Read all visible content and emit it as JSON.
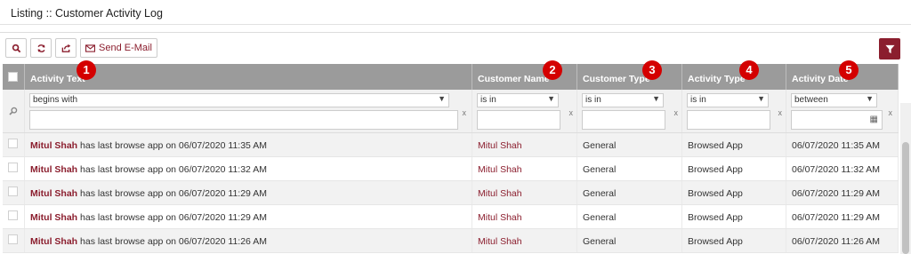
{
  "page": {
    "title": "Listing :: Customer Activity Log"
  },
  "toolbar": {
    "search_icon": "search-icon",
    "refresh_icon": "refresh-icon",
    "export_icon": "export-icon",
    "email_label": "Send E-Mail",
    "filter_icon": "funnel-icon",
    "accent_color": "#8b1e2e"
  },
  "columns": [
    {
      "label": "Activity Text",
      "badge": "1"
    },
    {
      "label": "Customer Name",
      "badge": "2"
    },
    {
      "label": "Customer Type",
      "badge": "3"
    },
    {
      "label": "Activity Type",
      "badge": "4"
    },
    {
      "label": "Activity Date",
      "badge": "5"
    }
  ],
  "filters": [
    {
      "operator": "begins with",
      "value": "",
      "clear": "x"
    },
    {
      "operator": "is in",
      "value": "",
      "clear": "x"
    },
    {
      "operator": "is in",
      "value": "",
      "clear": "x"
    },
    {
      "operator": "is in",
      "value": "",
      "clear": "x"
    },
    {
      "operator": "between",
      "value": "",
      "clear": "x"
    }
  ],
  "rows": [
    {
      "name": "Mitul Shah",
      "text": " has last browse app on 06/07/2020 11:35 AM",
      "customer": "Mitul Shah",
      "type": "General",
      "activity": "Browsed App",
      "date": "06/07/2020 11:35 AM"
    },
    {
      "name": "Mitul Shah",
      "text": " has last browse app on 06/07/2020 11:32 AM",
      "customer": "Mitul Shah",
      "type": "General",
      "activity": "Browsed App",
      "date": "06/07/2020 11:32 AM"
    },
    {
      "name": "Mitul Shah",
      "text": " has last browse app on 06/07/2020 11:29 AM",
      "customer": "Mitul Shah",
      "type": "General",
      "activity": "Browsed App",
      "date": "06/07/2020 11:29 AM"
    },
    {
      "name": "Mitul Shah",
      "text": " has last browse app on 06/07/2020 11:29 AM",
      "customer": "Mitul Shah",
      "type": "General",
      "activity": "Browsed App",
      "date": "06/07/2020 11:29 AM"
    },
    {
      "name": "Mitul Shah",
      "text": " has last browse app on 06/07/2020 11:26 AM",
      "customer": "Mitul Shah",
      "type": "General",
      "activity": "Browsed App",
      "date": "06/07/2020 11:26 AM"
    }
  ]
}
